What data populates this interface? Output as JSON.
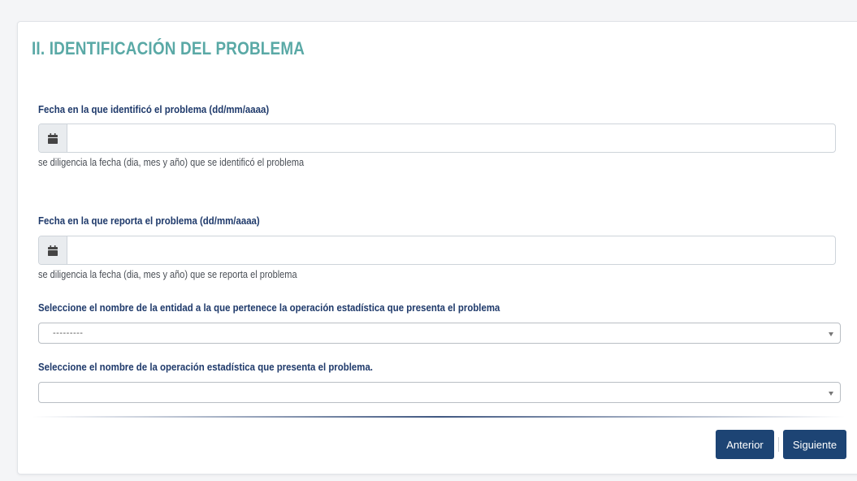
{
  "section": {
    "title": "II. IDENTIFICACIÓN DEL PROBLEMA"
  },
  "fields": {
    "identified_date": {
      "label": "Fecha en la que identificó el problema (dd/mm/aaaa)",
      "value": "",
      "icon": "calendar-icon",
      "help": "se diligencia la fecha (dia, mes y año) que se identificó el problema"
    },
    "report_date": {
      "label": "Fecha en la que reporta el problema (dd/mm/aaaa)",
      "value": "",
      "icon": "calendar-icon",
      "help": "se diligencia la fecha (dia, mes y año) que se reporta el problema"
    },
    "entity": {
      "label": "Seleccione el nombre de la entidad a la que pertenece la operación estadística que presenta el problema",
      "selected": "---------"
    },
    "operation": {
      "label": "Seleccione el nombre de la operación estadística que presenta el problema.",
      "selected": ""
    }
  },
  "buttons": {
    "previous": "Anterior",
    "next": "Siguiente"
  },
  "colors": {
    "title": "#5aa9a6",
    "label": "#1f3a6b",
    "button": "#1d4474"
  }
}
